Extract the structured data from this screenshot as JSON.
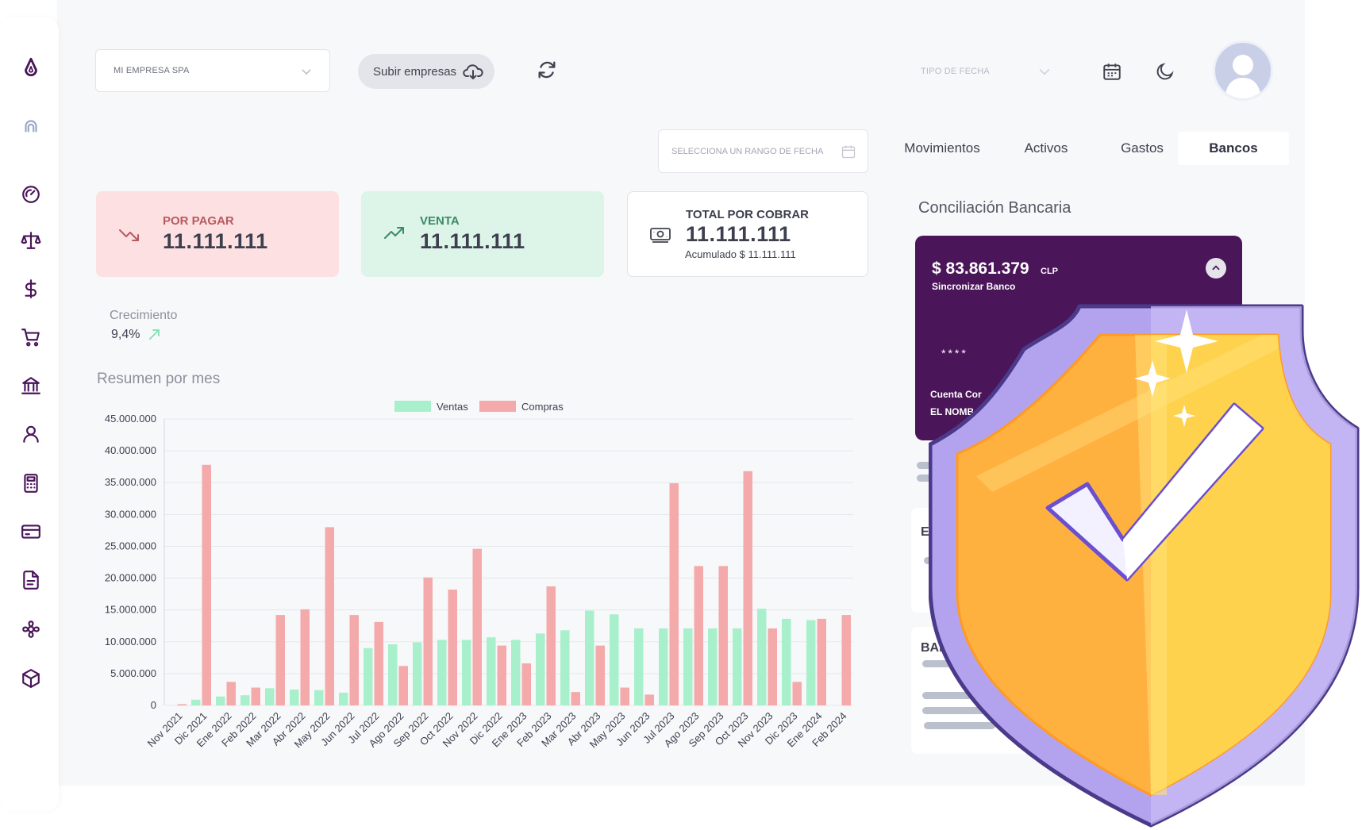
{
  "header": {
    "company": "MI EMPRESA SPA",
    "upload_label": "Subir empresas",
    "date_type_placeholder": "TIPO DE FECHA"
  },
  "date_range": {
    "placeholder": "SELECCIONA UN RANGO DE FECHA"
  },
  "tabs": [
    {
      "label": "Movimientos",
      "active": false
    },
    {
      "label": "Activos",
      "active": false
    },
    {
      "label": "Gastos",
      "active": false
    },
    {
      "label": "Bancos",
      "active": true
    }
  ],
  "cards": {
    "pagar": {
      "label": "POR PAGAR",
      "value": "11.111.111",
      "color": "#b85a60",
      "icon": "trending-down-icon"
    },
    "venta": {
      "label": "VENTA",
      "value": "11.111.111",
      "color": "#3d8a66",
      "icon": "trending-up-icon"
    },
    "cobrar": {
      "label": "TOTAL POR COBRAR",
      "value": "11.111.111",
      "sub": "Acumulado $ 11.111.111",
      "icon": "money-icon"
    }
  },
  "growth": {
    "label": "Crecimiento",
    "value": "9,4%"
  },
  "summary_title": "Resumen por mes",
  "colors": {
    "brand": "#4a1559",
    "ventas": "#a8f0cc",
    "compras": "#f4aaaa"
  },
  "conciliation": {
    "title": "Conciliación Bancaria",
    "amount": "$ 83.861.379",
    "currency": "CLP",
    "sync": "Sincronizar Banco",
    "masked": "****",
    "account": "Cuenta Cor",
    "owner": "EL NOMB",
    "panel1": "EN",
    "panel2": "BANCO"
  },
  "sidebar_icons": [
    "logo-icon",
    "user-outline-icon",
    "dashboard-gauge-icon",
    "balance-scale-icon",
    "dollar-icon",
    "cart-icon",
    "bank-icon",
    "person-icon",
    "calculator-icon",
    "credit-card-icon",
    "document-icon",
    "settings-flower-icon",
    "box-icon"
  ],
  "chart_data": {
    "type": "bar",
    "categories": [
      "Nov 2021",
      "Dic 2021",
      "Ene 2022",
      "Feb 2022",
      "Mar 2022",
      "Abr 2022",
      "May 2022",
      "Jun 2022",
      "Jul 2022",
      "Ago 2022",
      "Sep 2022",
      "Oct 2022",
      "Nov 2022",
      "Dic 2022",
      "Ene 2023",
      "Feb 2023",
      "Mar 2023",
      "Abr 2023",
      "May 2023",
      "Jun 2023",
      "Jul 2023",
      "Ago 2023",
      "Sep 2023",
      "Oct 2023",
      "Nov 2023",
      "Dic 2023",
      "Ene 2024",
      "Feb 2024"
    ],
    "series": [
      {
        "name": "Ventas",
        "color": "#a8f0cc",
        "values": [
          0,
          900000,
          1400000,
          1600000,
          2700000,
          2500000,
          2400000,
          2000000,
          9000000,
          9600000,
          9900000,
          10300000,
          10300000,
          10700000,
          10300000,
          11300000,
          11800000,
          14900000,
          14300000,
          12100000,
          12100000,
          12100000,
          12100000,
          12100000,
          15200000,
          13600000,
          13400000,
          0
        ]
      },
      {
        "name": "Compras",
        "color": "#f4aaaa",
        "values": [
          200000,
          37800000,
          3700000,
          2800000,
          14200000,
          15100000,
          28000000,
          14200000,
          13100000,
          6200000,
          20100000,
          18200000,
          24600000,
          9400000,
          6600000,
          18700000,
          2100000,
          9400000,
          2800000,
          1700000,
          34900000,
          21900000,
          21900000,
          36800000,
          12100000,
          3700000,
          13600000,
          14200000
        ]
      }
    ],
    "ylim": [
      0,
      45000000
    ],
    "yticks": [
      "45.000.000",
      "40.000.000",
      "35.000.000",
      "30.000.000",
      "25.000.000",
      "20.000.000",
      "15.000.000",
      "10.000.000",
      "5.000.000",
      "0"
    ],
    "ytick_values": [
      45000000,
      40000000,
      35000000,
      30000000,
      25000000,
      20000000,
      15000000,
      10000000,
      5000000,
      0
    ],
    "grid": true,
    "legend": "top-center"
  }
}
